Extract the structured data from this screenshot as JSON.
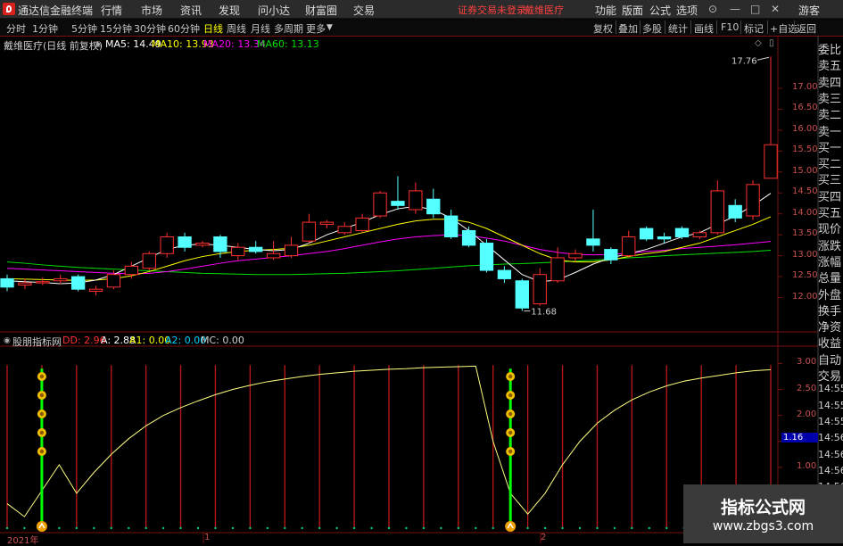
{
  "app": {
    "name": "通达信金融终端",
    "warn": "证券交易未登录",
    "stock": "戴维医疗"
  },
  "menu": [
    "行情",
    "市场",
    "资讯",
    "发现",
    "问小达",
    "财富圈",
    "交易"
  ],
  "right_menu": [
    "功能",
    "版面",
    "公式",
    "选项"
  ],
  "guest": "游客",
  "periods": [
    "分时",
    "1分钟",
    "5分钟",
    "15分钟",
    "30分钟",
    "60分钟",
    "日线",
    "周线",
    "月线",
    "多周期",
    "更多"
  ],
  "active_period": "日线",
  "tools": [
    "复权",
    "叠加",
    "多股",
    "统计",
    "画线",
    "F10",
    "标记",
    "+自选",
    "返回"
  ],
  "main_header": {
    "title": "戴维医疗(日线 前复权)",
    "ma": [
      {
        "label": "MA5: 14.49",
        "color": "#ffffff"
      },
      {
        "label": "MA10: 13.93",
        "color": "#ffff00"
      },
      {
        "label": "MA20: 13.34",
        "color": "#ff00ff"
      },
      {
        "label": "MA60: 13.13",
        "color": "#00e000"
      }
    ]
  },
  "sub_header": {
    "title": "股朋指标网",
    "items": [
      {
        "label": "DD: 2.96",
        "color": "#ff3030"
      },
      {
        "label": "A: 2.88",
        "color": "#ffffff"
      },
      {
        "label": "A1: 0.00",
        "color": "#ffff00"
      },
      {
        "label": "A2: 0.00",
        "color": "#00d0ff"
      },
      {
        "label": "MC: 0.00",
        "color": "#d0d0d0"
      }
    ]
  },
  "right_panel": [
    "委比",
    "卖五",
    "卖四",
    "卖三",
    "卖二",
    "卖一",
    "买一",
    "买二",
    "买三",
    "买四",
    "买五",
    "现价",
    "涨跌",
    "涨幅",
    "总量",
    "外盘",
    "换手",
    "净资",
    "收益",
    "自动",
    "交易",
    "14:55",
    "14:55",
    "14:55",
    "14:56",
    "14:56",
    "14:56",
    "14:56",
    "14:56",
    "14:56"
  ],
  "price_axis": [
    "17.00",
    "16.50",
    "16.00",
    "15.50",
    "15.00",
    "14.50",
    "14.00",
    "13.50",
    "13.00",
    "12.50",
    "12.00"
  ],
  "sub_axis": [
    "3.00",
    "2.50",
    "2.00",
    "1.50",
    "1.00",
    "0.50"
  ],
  "sub_axis_highlight": "1.16",
  "max_label": "17.76",
  "min_label": "11.68",
  "dates": [
    "2021年",
    "1",
    "2"
  ],
  "watermark": {
    "line1": "指标公式网",
    "line2": "www.zbgs3.com"
  },
  "colors": {
    "up": "#ff3030",
    "down": "#54ffff",
    "ma5": "#ffffff",
    "ma10": "#ffff00",
    "ma20": "#ff00ff",
    "ma60": "#00e000",
    "grid": "#7a1010"
  },
  "chart_data": {
    "type": "candlestick",
    "price_range": [
      11.5,
      18.0
    ],
    "candles": [
      [
        12.45,
        12.25,
        12.55,
        12.15
      ],
      [
        12.3,
        12.35,
        12.45,
        12.2
      ],
      [
        12.35,
        12.38,
        12.48,
        12.3
      ],
      [
        12.4,
        12.45,
        12.55,
        12.32
      ],
      [
        12.5,
        12.2,
        12.55,
        12.15
      ],
      [
        12.15,
        12.2,
        12.28,
        12.05
      ],
      [
        12.25,
        12.55,
        12.65,
        12.2
      ],
      [
        12.55,
        12.75,
        12.85,
        12.45
      ],
      [
        12.7,
        13.05,
        13.1,
        12.65
      ],
      [
        13.05,
        13.45,
        13.55,
        12.95
      ],
      [
        13.45,
        13.2,
        13.55,
        13.1
      ],
      [
        13.25,
        13.3,
        13.35,
        13.2
      ],
      [
        13.45,
        13.1,
        13.5,
        12.95
      ],
      [
        13.0,
        13.2,
        13.3,
        12.9
      ],
      [
        13.2,
        13.1,
        13.35,
        13.05
      ],
      [
        12.95,
        13.05,
        13.35,
        12.9
      ],
      [
        13.0,
        13.25,
        13.45,
        12.95
      ],
      [
        13.35,
        13.8,
        14.0,
        13.3
      ],
      [
        13.75,
        13.8,
        13.85,
        13.65
      ],
      [
        13.55,
        13.7,
        13.8,
        13.5
      ],
      [
        13.6,
        13.9,
        14.0,
        13.55
      ],
      [
        13.95,
        14.5,
        14.55,
        13.9
      ],
      [
        14.3,
        14.2,
        14.9,
        14.1
      ],
      [
        14.1,
        14.55,
        14.75,
        14.0
      ],
      [
        14.35,
        14.0,
        14.6,
        13.9
      ],
      [
        13.95,
        13.45,
        14.1,
        13.4
      ],
      [
        13.6,
        13.25,
        13.7,
        13.2
      ],
      [
        13.3,
        12.65,
        13.4,
        12.6
      ],
      [
        12.65,
        12.45,
        12.75,
        12.35
      ],
      [
        12.4,
        11.75,
        12.45,
        11.68
      ],
      [
        11.85,
        12.55,
        12.7,
        11.8
      ],
      [
        12.4,
        12.95,
        13.2,
        12.35
      ],
      [
        12.95,
        13.05,
        13.15,
        12.85
      ],
      [
        13.4,
        13.25,
        14.1,
        13.1
      ],
      [
        13.15,
        12.9,
        13.2,
        12.8
      ],
      [
        13.0,
        13.45,
        13.6,
        12.95
      ],
      [
        13.65,
        13.4,
        13.7,
        13.35
      ],
      [
        13.45,
        13.4,
        13.55,
        13.3
      ],
      [
        13.65,
        13.45,
        13.7,
        13.4
      ],
      [
        13.45,
        13.55,
        13.6,
        13.4
      ],
      [
        13.55,
        14.55,
        14.8,
        13.5
      ],
      [
        14.2,
        13.9,
        14.35,
        13.8
      ],
      [
        13.95,
        14.7,
        14.8,
        13.85
      ],
      [
        14.85,
        15.65,
        17.76,
        14.85
      ]
    ],
    "ma5": [
      12.4,
      12.38,
      12.36,
      12.33,
      12.35,
      12.42,
      12.55,
      12.75,
      12.95,
      13.15,
      13.25,
      13.28,
      13.25,
      13.2,
      13.15,
      13.12,
      13.15,
      13.3,
      13.5,
      13.65,
      13.8,
      13.98,
      14.12,
      14.18,
      14.1,
      13.9,
      13.6,
      13.25,
      12.9,
      12.55,
      12.38,
      12.42,
      12.6,
      12.8,
      12.95,
      13.05,
      13.15,
      13.3,
      13.45,
      13.55,
      13.75,
      13.95,
      14.2,
      14.49
    ],
    "ma10": [
      12.45,
      12.44,
      12.43,
      12.42,
      12.41,
      12.42,
      12.45,
      12.52,
      12.62,
      12.75,
      12.88,
      12.98,
      13.05,
      13.1,
      13.13,
      13.15,
      13.18,
      13.25,
      13.35,
      13.45,
      13.55,
      13.65,
      13.75,
      13.83,
      13.87,
      13.87,
      13.8,
      13.65,
      13.45,
      13.25,
      13.05,
      12.9,
      12.85,
      12.85,
      12.9,
      12.98,
      13.05,
      13.1,
      13.2,
      13.3,
      13.45,
      13.6,
      13.75,
      13.93
    ],
    "ma20": [
      12.7,
      12.68,
      12.66,
      12.64,
      12.62,
      12.6,
      12.58,
      12.57,
      12.58,
      12.62,
      12.68,
      12.75,
      12.82,
      12.88,
      12.92,
      12.96,
      13.0,
      13.05,
      13.1,
      13.17,
      13.25,
      13.33,
      13.4,
      13.45,
      13.48,
      13.5,
      13.48,
      13.42,
      13.35,
      13.25,
      13.15,
      13.08,
      13.03,
      13.02,
      13.03,
      13.06,
      13.1,
      13.13,
      13.17,
      13.2,
      13.23,
      13.26,
      13.3,
      13.34
    ],
    "ma60": [
      12.85,
      12.82,
      12.78,
      12.75,
      12.72,
      12.7,
      12.68,
      12.66,
      12.64,
      12.62,
      12.6,
      12.58,
      12.57,
      12.56,
      12.55,
      12.55,
      12.55,
      12.56,
      12.57,
      12.58,
      12.6,
      12.62,
      12.64,
      12.67,
      12.7,
      12.73,
      12.76,
      12.78,
      12.8,
      12.81,
      12.83,
      12.85,
      12.87,
      12.89,
      12.92,
      12.95,
      12.97,
      13.0,
      13.02,
      13.04,
      13.06,
      13.08,
      13.1,
      13.13
    ],
    "sub": {
      "range": [
        0,
        3.3
      ],
      "a_line": [
        0.3,
        0.05,
        0.55,
        1.05,
        0.5,
        0.9,
        1.25,
        1.55,
        1.8,
        2.0,
        2.15,
        2.28,
        2.4,
        2.5,
        2.58,
        2.65,
        2.7,
        2.75,
        2.79,
        2.82,
        2.85,
        2.87,
        2.89,
        2.9,
        2.92,
        2.93,
        2.94,
        2.95,
        1.5,
        0.5,
        0.1,
        0.5,
        1.05,
        1.5,
        1.85,
        2.1,
        2.3,
        2.45,
        2.57,
        2.66,
        2.72,
        2.77,
        2.82,
        2.86,
        2.88
      ],
      "signal_bars_at": [
        2,
        29
      ],
      "signal_height": 2.9
    }
  }
}
